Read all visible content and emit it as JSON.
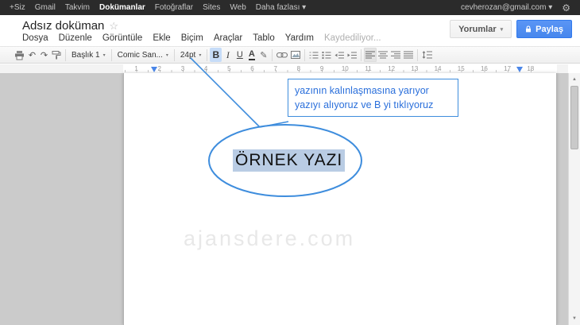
{
  "topbar": {
    "items": [
      "+Siz",
      "Gmail",
      "Takvim",
      "Dokümanlar",
      "Fotoğraflar",
      "Sites",
      "Web",
      "Daha fazlası ▾"
    ],
    "account": "cevherozan@gmail.com ▾",
    "gear": "⚙"
  },
  "header": {
    "title": "Adsız doküman",
    "star": "☆",
    "menus": [
      "Dosya",
      "Düzenle",
      "Görüntüle",
      "Ekle",
      "Biçim",
      "Araçlar",
      "Tablo",
      "Yardım"
    ],
    "saving": "Kaydediliyor...",
    "comments": "Yorumlar",
    "share": "Paylaş",
    "caret": "▾"
  },
  "toolbar": {
    "undo": "↶",
    "redo": "↷",
    "style": "Başlık 1",
    "font": "Comic San...",
    "size": "24pt",
    "bold": "B",
    "italic": "I",
    "underline": "U",
    "text_color": "A",
    "highlight": "✎",
    "arrow": "▾"
  },
  "ruler": {
    "numbers": [
      "1",
      "2",
      "3",
      "4",
      "5",
      "6",
      "7",
      "8",
      "9",
      "10",
      "11",
      "12",
      "13",
      "14",
      "15",
      "16",
      "17",
      "18"
    ]
  },
  "page": {
    "text": "ÖRNEK YAZI",
    "watermark": "ajansdere.com"
  },
  "callout": {
    "line1": "yazının kalınlaşmasına yarıyor",
    "line2": "yazıyı alıyoruz ve B yi tıklıyoruz"
  },
  "scrollbar": {
    "up": "▲",
    "down": "▼"
  },
  "colors": {
    "share_blue": "#4787ed",
    "callout_blue": "#3e8ddd",
    "selection_blue": "#b9cce4",
    "bold_active_bg": "#c6dcf8",
    "topbar_bg": "#2b2b2b"
  }
}
